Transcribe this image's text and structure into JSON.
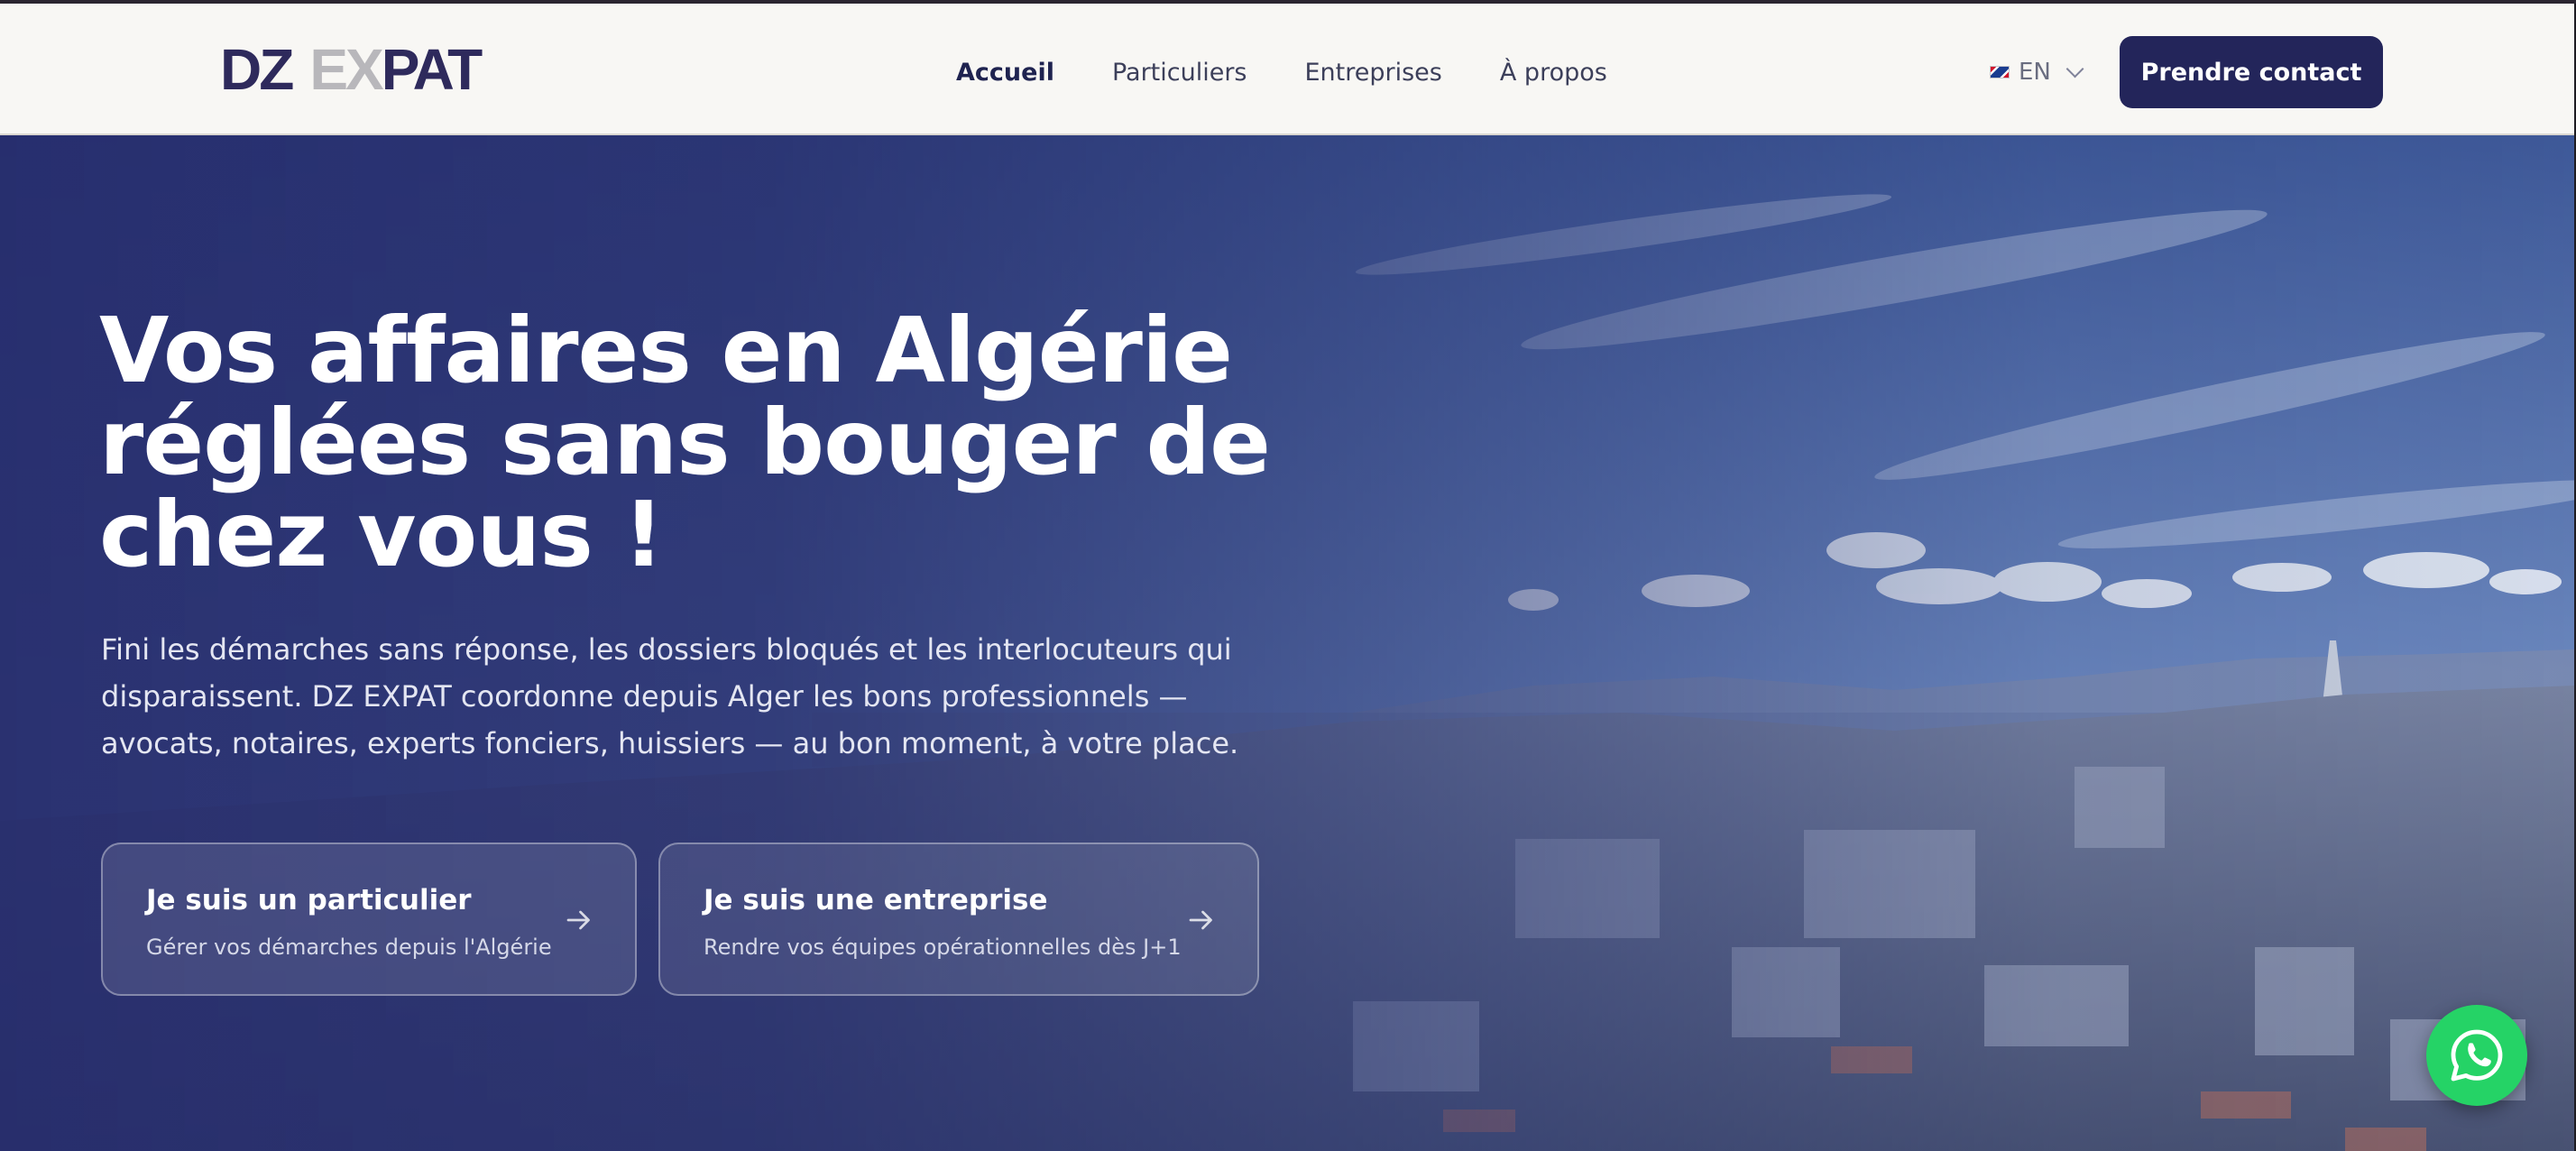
{
  "header": {
    "logo": {
      "part1": "DZ",
      "part2": "EX",
      "part3": "PAT"
    },
    "nav": [
      {
        "label": "Accueil",
        "active": true
      },
      {
        "label": "Particuliers",
        "active": false
      },
      {
        "label": "Entreprises",
        "active": false
      },
      {
        "label": "À propos",
        "active": false
      }
    ],
    "language": {
      "label": "EN",
      "flag_icon": "uk-flag-icon"
    },
    "cta_label": "Prendre contact"
  },
  "hero": {
    "title_lines": [
      "Vos affaires en Algérie",
      "réglées sans bouger de",
      "chez vous !"
    ],
    "subtitle": "Fini les démarches sans réponse, les dossiers bloqués et les interlocuteurs qui disparaissent. DZ EXPAT coordonne depuis Alger les bons professionnels — avocats, notaires, experts fonciers, huissiers — au bon moment, à votre place.",
    "cards": [
      {
        "title": "Je suis un particulier",
        "description": "Gérer vos démarches depuis l'Algérie",
        "icon": "arrow-right-icon"
      },
      {
        "title": "Je suis une entreprise",
        "description": "Rendre vos équipes opérationnelles dès J+1",
        "icon": "arrow-right-icon"
      }
    ]
  },
  "floating": {
    "whatsapp_icon": "whatsapp-icon"
  },
  "colors": {
    "brand_navy": "#23255a",
    "header_bg": "#f8f7f4",
    "logo_gray": "#b8b7bb",
    "whatsapp_green": "#25d366"
  }
}
